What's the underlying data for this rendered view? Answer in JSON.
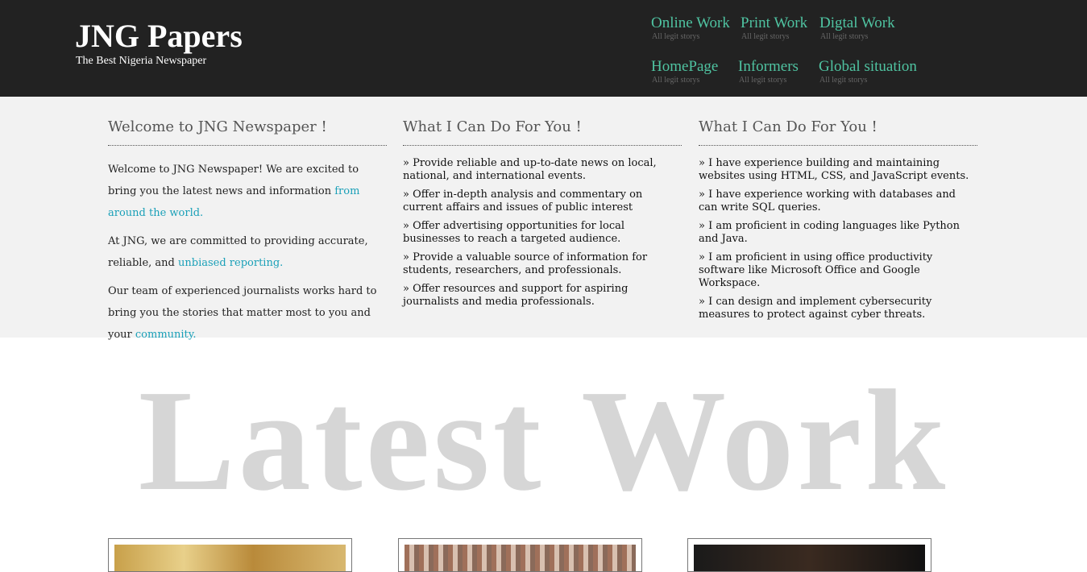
{
  "header": {
    "logo": "JNG Papers",
    "tagline": "The Best Nigeria Newspaper"
  },
  "nav": [
    {
      "label": "Online Work",
      "sub": "All legit storys"
    },
    {
      "label": "Print Work",
      "sub": "All legit storys"
    },
    {
      "label": "Digtal Work",
      "sub": "All legit storys"
    },
    {
      "label": "HomePage",
      "sub": "All legit storys"
    },
    {
      "label": "Informers",
      "sub": "All legit storys"
    },
    {
      "label": "Global situation",
      "sub": "All legit storys"
    }
  ],
  "col1": {
    "title": "Welcome to JNG Newspaper !",
    "p1_text": "Welcome to JNG Newspaper! We are excited to bring you the latest news and information ",
    "p1_link": "from around the world.",
    "p2_text": "At JNG, we are committed to providing accurate, reliable, and ",
    "p2_link": "unbiased reporting.",
    "p3_text": "Our team of experienced journalists works hard to bring you the stories that matter most to you and your ",
    "p3_link": "community."
  },
  "col2": {
    "title": "What I Can Do For You !",
    "items": [
      "» Provide reliable and up-to-date news on local, national, and international events.",
      "» Offer in-depth analysis and commentary on current affairs and issues of public interest",
      "» Offer advertising opportunities for local businesses to reach a targeted audience.",
      "» Provide a valuable source of information for students, researchers, and professionals.",
      "» Offer resources and support for aspiring journalists and media professionals."
    ]
  },
  "col3": {
    "title": "What I Can Do For You !",
    "items": [
      "» I have experience building and maintaining websites using HTML, CSS, and JavaScript events.",
      "» I have experience working with databases and can write SQL queries.",
      "» I am proficient in coding languages like Python and Java.",
      "» I am proficient in using office productivity software like Microsoft Office and Google Workspace.",
      "» I can design and implement cybersecurity measures to protect against cyber threats."
    ]
  },
  "latest": {
    "heading": "Latest Work"
  },
  "colors": {
    "header_bg": "#222222",
    "nav_accent": "#4fc3a1",
    "link": "#1aa0b8",
    "band_bg": "#f2f2f2"
  }
}
